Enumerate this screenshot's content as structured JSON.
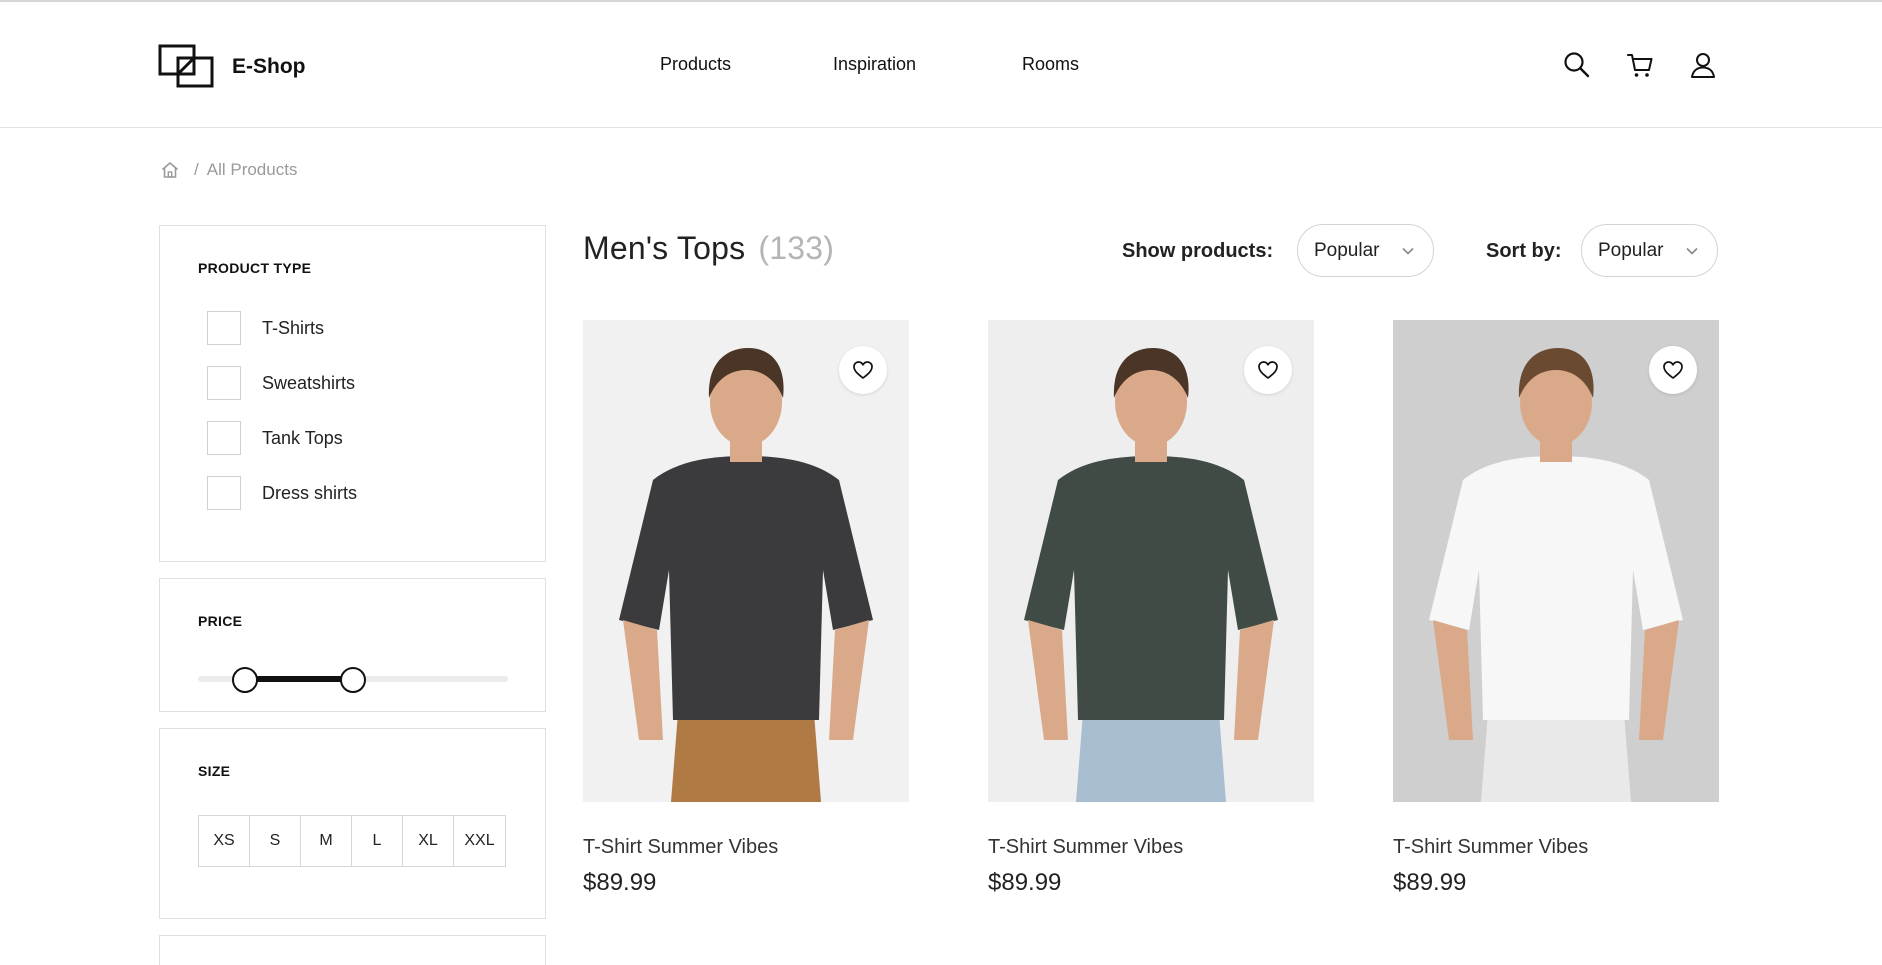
{
  "header": {
    "logo_text": "E-Shop",
    "nav": [
      {
        "label": "Products"
      },
      {
        "label": "Inspiration"
      },
      {
        "label": "Rooms"
      }
    ],
    "icons": [
      "search-icon",
      "cart-icon",
      "user-icon"
    ]
  },
  "breadcrumb": {
    "home_icon": "home-icon",
    "separator": "/",
    "current": "All Products"
  },
  "filters": {
    "product_type": {
      "title": "PRODUCT TYPE",
      "options": [
        {
          "label": "T-Shirts",
          "checked": false
        },
        {
          "label": "Sweatshirts",
          "checked": false
        },
        {
          "label": "Tank Tops",
          "checked": false
        },
        {
          "label": "Dress shirts",
          "checked": false
        }
      ]
    },
    "price": {
      "title": "PRICE",
      "range_fraction": [
        0.15,
        0.5
      ]
    },
    "size": {
      "title": "SIZE",
      "options": [
        "XS",
        "S",
        "M",
        "L",
        "XL",
        "XXL"
      ]
    }
  },
  "main": {
    "title": "Men's Tops",
    "count": "(133)",
    "show_products_label": "Show products:",
    "show_products_value": "Popular",
    "sort_by_label": "Sort by:",
    "sort_by_value": "Popular"
  },
  "products": [
    {
      "name": "T-Shirt Summer Vibes",
      "price": "$89.99",
      "shirt_color": "#3b3b3d",
      "bg": "#f1f1f1",
      "pants": "#b07a45"
    },
    {
      "name": "T-Shirt Summer Vibes",
      "price": "$89.99",
      "shirt_color": "#3f4b44",
      "bg": "#eeeeee",
      "pants": "#a9bdd1"
    },
    {
      "name": "T-Shirt Summer Vibes",
      "price": "$89.99",
      "shirt_color": "#f7f7f7",
      "bg": "#cfcfcf",
      "pants": "#e9e9e9"
    }
  ],
  "colors": {
    "accent": "#111111",
    "muted_text": "#9a9a9a",
    "border": "#e0e0e0"
  }
}
